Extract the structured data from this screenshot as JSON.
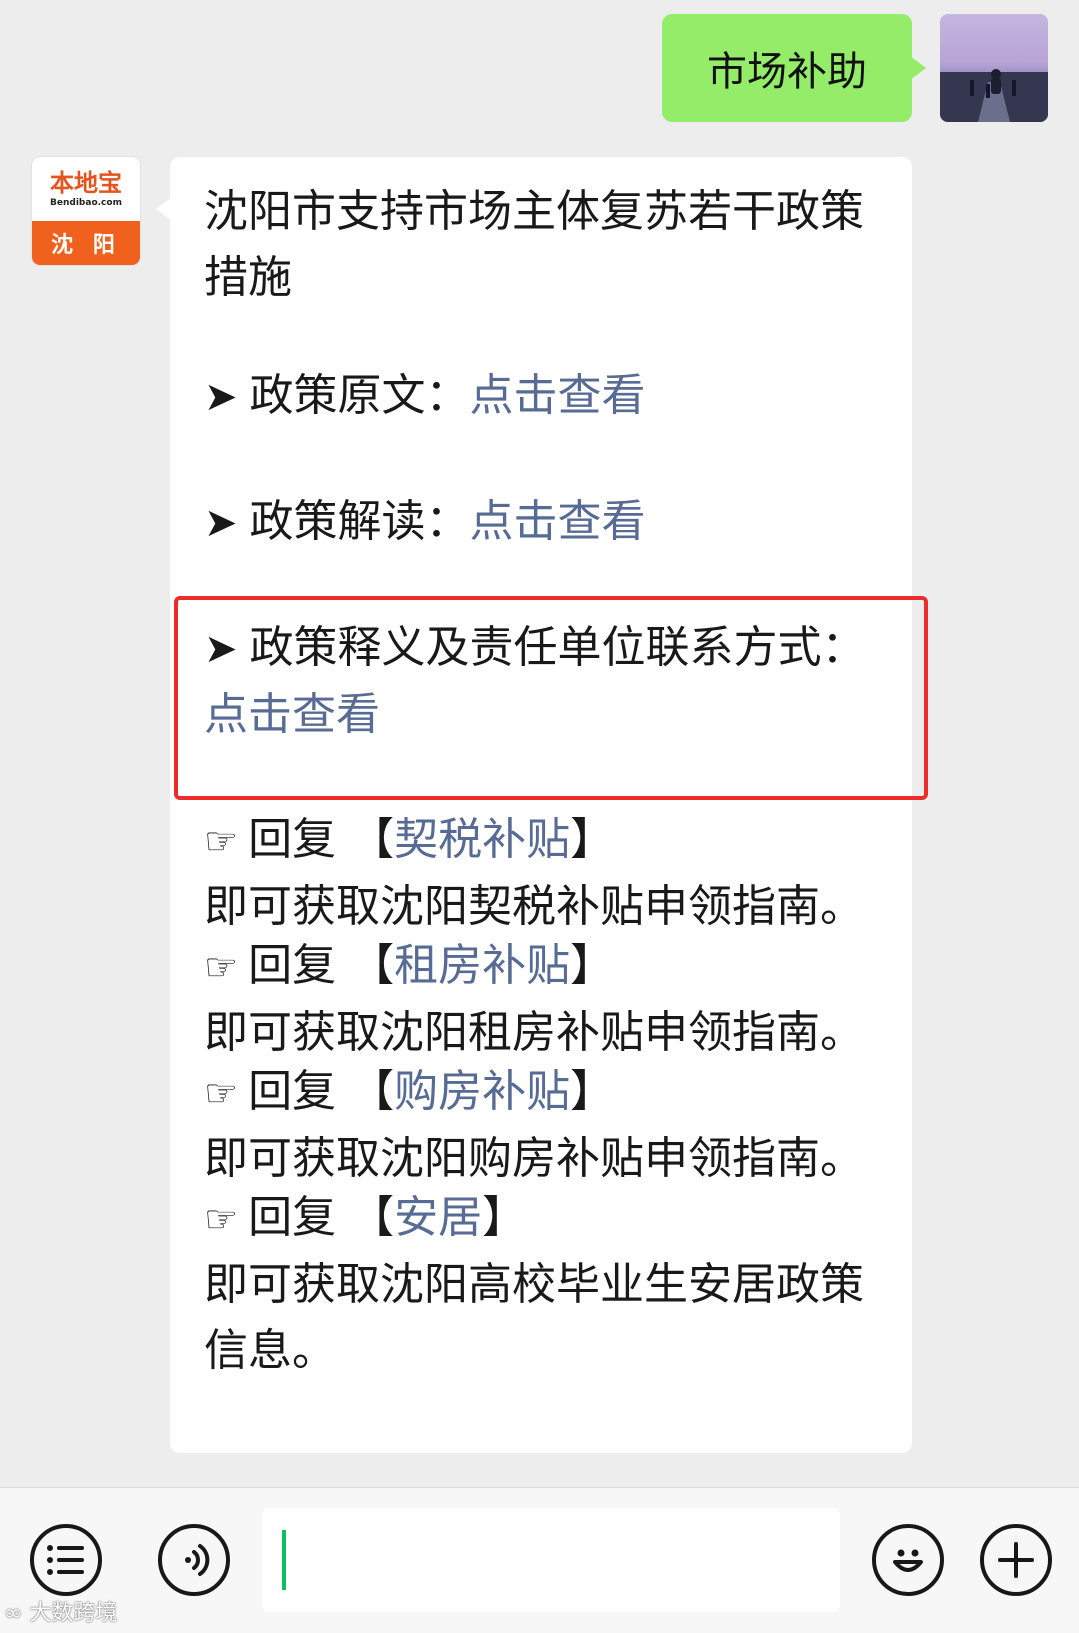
{
  "chat": {
    "outgoing": {
      "text": "市场补助"
    },
    "bot": {
      "brand": "本地宝",
      "site": "Bendibao.com",
      "city": "沈 阳"
    },
    "incoming": {
      "title": "沈阳市支持市场主体复苏若干政策措施",
      "arrow_glyph": "➤",
      "hand_glyph": "☞",
      "items": [
        {
          "label": "政策原文：",
          "link": "点击查看"
        },
        {
          "label": "政策解读：",
          "link": "点击查看"
        },
        {
          "label": "政策释义及责任单位联系方式：",
          "link": "点击查看"
        }
      ],
      "replies": [
        {
          "prefix": "回复",
          "open": "【",
          "keyword": "契税补贴",
          "close": "】",
          "desc": "即可获取沈阳契税补贴申领指南。"
        },
        {
          "prefix": "回复",
          "open": "【",
          "keyword": "租房补贴",
          "close": "】",
          "desc": "即可获取沈阳租房补贴申领指南。"
        },
        {
          "prefix": "回复",
          "open": "【",
          "keyword": "购房补贴",
          "close": "】",
          "desc": "即可获取沈阳购房补贴申领指南。"
        },
        {
          "prefix": "回复",
          "open": "【",
          "keyword": "安居",
          "close": "】",
          "desc": "即可获取沈阳高校毕业生安居政策信息。"
        }
      ]
    }
  },
  "input_bar": {
    "menu_icon": "list-icon",
    "voice_icon": "voice-icon",
    "emoji_icon": "smile-icon",
    "plus_icon": "plus-icon"
  },
  "watermark": {
    "text": "大数跨境"
  },
  "colors": {
    "outgoing_bubble": "#95ec69",
    "link": "#576b95",
    "highlight_border": "#ec2c2a",
    "caret": "#07c160"
  }
}
